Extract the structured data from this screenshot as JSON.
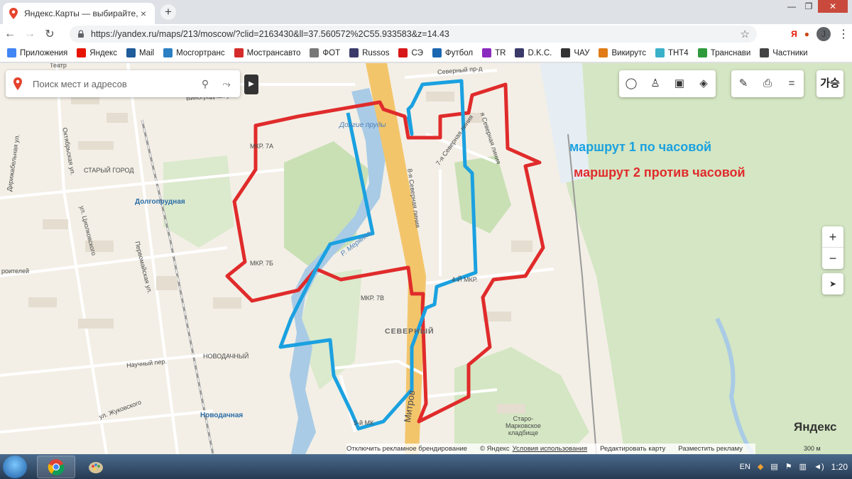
{
  "browser": {
    "tab_title": "Яндекс.Карты — выбирайте, где п",
    "tab_close": "×",
    "new_tab": "+",
    "url": "https://yandex.ru/maps/213/moscow/?clid=2163430&ll=37.560572%2C55.933583&z=14.43",
    "profile_initial": "J",
    "window_controls": [
      "—",
      "❐",
      "✕"
    ]
  },
  "bookmarks": [
    {
      "label": "Приложения",
      "icon": "apps-grid-icon",
      "color": "#4285f4"
    },
    {
      "label": "Яндекс",
      "icon": "yandex-icon",
      "color": "#e61400"
    },
    {
      "label": "Mail",
      "icon": "mail-icon",
      "color": "#1e5c9a"
    },
    {
      "label": "Мосгортранс",
      "icon": "mosgortrans-icon",
      "color": "#2b7fc3"
    },
    {
      "label": "Мострансавто",
      "icon": "mostrans-icon",
      "color": "#d42a2a"
    },
    {
      "label": "ФОТ",
      "icon": "document-icon",
      "color": "#777777"
    },
    {
      "label": "Russos",
      "icon": "user-icon",
      "color": "#3a3a6a"
    },
    {
      "label": "СЭ",
      "icon": "se-icon",
      "color": "#d81818"
    },
    {
      "label": "Футбол",
      "icon": "football-icon",
      "color": "#1c67b1"
    },
    {
      "label": "TR",
      "icon": "tr-icon",
      "color": "#8a2bbf"
    },
    {
      "label": "D.K.C.",
      "icon": "user-icon",
      "color": "#3a3a6a"
    },
    {
      "label": "ЧАУ",
      "icon": "t-icon",
      "color": "#333333"
    },
    {
      "label": "Викирутс",
      "icon": "w-icon",
      "color": "#e07b18"
    },
    {
      "label": "ТНТ4",
      "icon": "tnt-icon",
      "color": "#3bb0c9"
    },
    {
      "label": "Транснави",
      "icon": "transnavi-icon",
      "color": "#2e9a3c"
    },
    {
      "label": "Частники",
      "icon": "globe-icon",
      "color": "#444444"
    }
  ],
  "search": {
    "placeholder": "Поиск мест и адресов"
  },
  "map_labels": {
    "dolgie_prudy": "Долгие пруды",
    "severny_pr": "Северный пр-д",
    "vinogradnaya": "Виноградная ул.",
    "oktyabrskaya": "Октябрьская ул.",
    "dirizhabelnaya": "Дирижабельная ул.",
    "stary_gorod": "СТАРЫЙ ГОРОД",
    "dolgoprudnaya": "Долгопрудная",
    "tsiolkovskogo": "ул. Циолковского",
    "pervomayskaya": "Первомайская ул.",
    "stroiteley": "роителей",
    "mkr7a": "МКР. 7А",
    "mkr7b": "МКР. 7Б",
    "mkr7v": "МКР. 7В",
    "mkr4": "4-Й МКР.",
    "meryanka": "Р. Мерянка",
    "severnaya8": "8-я Северная линия",
    "severnaya7": "7-я Северная линия",
    "severnaya_ya": "я Северная линия",
    "severny": "СЕВЕРНЫЙ",
    "novodachny": "НОВОДАЧНЫЙ",
    "nauchny": "Научный пер.",
    "zhukovskogo": "ул. Жуковского",
    "novodachnaya": "Новодачная",
    "mitrov": "Митров",
    "mk_bottom": "9-й МК",
    "teatr": "Театр",
    "staro_markovskoe": "Старо-\nМарковское\nкладбище"
  },
  "legend": {
    "route1": "маршрут 1 по часовой",
    "route2": "маршрут 2 против часовой"
  },
  "colors": {
    "route1": "#1ba1e0",
    "route2": "#e02b2b"
  },
  "map_controls": {
    "zoom_in": "+",
    "zoom_out": "−",
    "menu": "=",
    "translate": "가승"
  },
  "brand": "Яндекс",
  "scale": "300 м",
  "footer": {
    "ad": "Отключить рекламное брендирование",
    "copyright": "© Яндекс",
    "terms": "Условия использования",
    "edit": "Редактировать карту",
    "place_ad": "Разместить рекламу"
  },
  "taskbar": {
    "lang": "EN",
    "time": "1:20"
  }
}
